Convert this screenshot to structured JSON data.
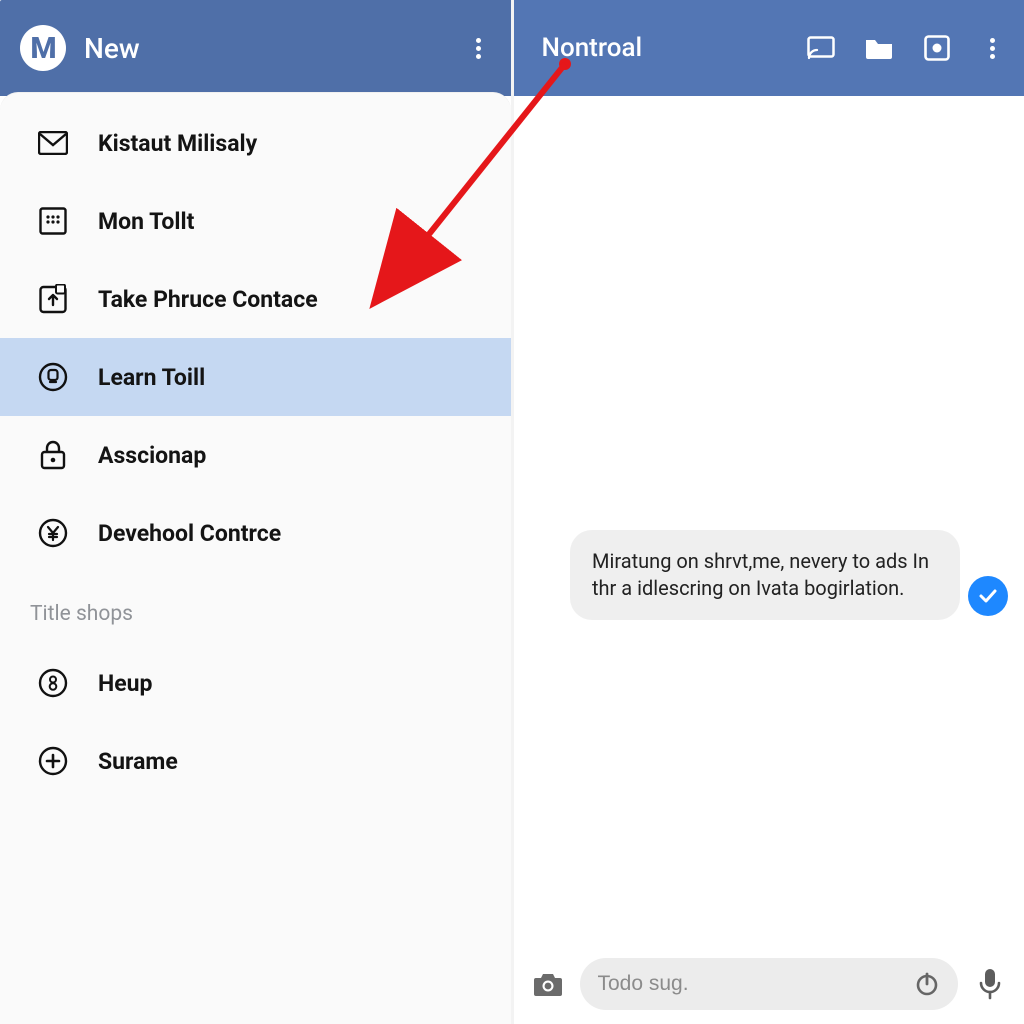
{
  "left": {
    "logo_letter": "M",
    "title": "New",
    "menu": [
      {
        "icon": "envelope-icon",
        "label": "Kistaut Milisaly"
      },
      {
        "icon": "grid-square-icon",
        "label": "Mon Tollt"
      },
      {
        "icon": "upload-card-icon",
        "label": "Take Phruce Contace"
      },
      {
        "icon": "coin-icon",
        "label": "Learn Toill"
      },
      {
        "icon": "lock-icon",
        "label": "Asscionap"
      },
      {
        "icon": "yen-circle-icon",
        "label": "Devehool Contrce"
      }
    ],
    "section_label": "Title shops",
    "secondary": [
      {
        "icon": "number-eight-icon",
        "label": "Heup"
      },
      {
        "icon": "plus-circle-icon",
        "label": "Surame"
      }
    ]
  },
  "right": {
    "title": "Nontroal",
    "message": "Miratung on shrvt,me, nevery to ads In thr a idlescring on Ivata bogirlation.",
    "input_placeholder": "Todo sug."
  },
  "annotation": {
    "arrow_color": "#e5171a"
  }
}
